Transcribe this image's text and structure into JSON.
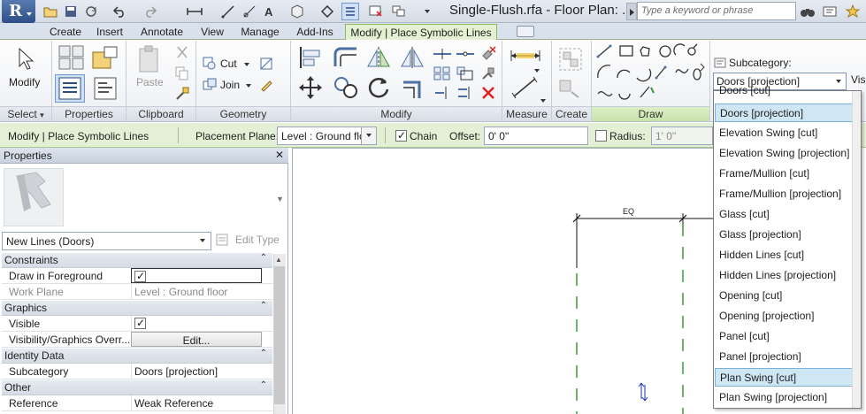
{
  "title_bar": {
    "app_logo": "R",
    "document_title": "Single-Flush.rfa - Floor Plan: ...",
    "search_placeholder": "Type a keyword or phrase"
  },
  "tabs": [
    {
      "label": "Create"
    },
    {
      "label": "Insert"
    },
    {
      "label": "Annotate"
    },
    {
      "label": "View"
    },
    {
      "label": "Manage"
    },
    {
      "label": "Add-Ins"
    },
    {
      "label": "Modify | Place Symbolic Lines",
      "active": true
    }
  ],
  "ribbon": {
    "select": {
      "button_label": "Modify",
      "panel_label": "Select"
    },
    "properties": {
      "panel_label": "Properties"
    },
    "clipboard": {
      "paste_label": "Paste",
      "panel_label": "Clipboard"
    },
    "geometry": {
      "cut_label": "Cut",
      "join_label": "Join",
      "panel_label": "Geometry"
    },
    "modify": {
      "panel_label": "Modify"
    },
    "measure": {
      "panel_label": "Measure"
    },
    "create": {
      "panel_label": "Create"
    },
    "draw": {
      "panel_label": "Draw"
    },
    "subcategory": {
      "label": "Subcategory:",
      "selected": "Doors [projection]",
      "vis_label": "Vis"
    }
  },
  "options_bar": {
    "context_label": "Modify | Place Symbolic Lines",
    "placement_plane_label": "Placement Plane:",
    "placement_plane_value": "Level : Ground flo",
    "chain_label": "Chain",
    "chain_checked": true,
    "offset_label": "Offset:",
    "offset_value": "0'  0\"",
    "radius_label": "Radius:",
    "radius_checked": false,
    "radius_value": "1'  0\""
  },
  "properties": {
    "title": "Properties",
    "type_selector": "New Lines (Doors)",
    "edit_type_label": "Edit Type",
    "categories": [
      {
        "name": "Constraints",
        "rows": [
          {
            "name": "Draw in Foreground",
            "value": "",
            "checkbox": true
          },
          {
            "name": "Work Plane",
            "value": "Level : Ground floor",
            "dim": true
          }
        ]
      },
      {
        "name": "Graphics",
        "rows": [
          {
            "name": "Visible",
            "value": "",
            "checkbox": true
          },
          {
            "name": "Visibility/Graphics Overr...",
            "value": "Edit...",
            "button": true
          }
        ]
      },
      {
        "name": "Identity Data",
        "rows": [
          {
            "name": "Subcategory",
            "value": "Doors [projection]"
          }
        ]
      },
      {
        "name": "Other",
        "rows": [
          {
            "name": "Reference",
            "value": "Weak Reference"
          }
        ]
      }
    ]
  },
  "canvas": {
    "dimension_label": "EQ"
  },
  "subcategory_list": {
    "options": [
      {
        "label": "Doors [cut]"
      },
      {
        "label": "Doors [projection]",
        "selected": true
      },
      {
        "label": "Elevation Swing [cut]"
      },
      {
        "label": "Elevation Swing [projection]"
      },
      {
        "label": "Frame/Mullion [cut]"
      },
      {
        "label": "Frame/Mullion [projection]"
      },
      {
        "label": "Glass [cut]"
      },
      {
        "label": "Glass [projection]"
      },
      {
        "label": "Hidden Lines [cut]"
      },
      {
        "label": "Hidden Lines [projection]"
      },
      {
        "label": "Opening [cut]"
      },
      {
        "label": "Opening [projection]"
      },
      {
        "label": "Panel [cut]"
      },
      {
        "label": "Panel [projection]"
      },
      {
        "label": "Plan Swing [cut]",
        "hover": true
      },
      {
        "label": "Plan Swing [projection]"
      }
    ]
  },
  "colors": {
    "accent_green": "#e4f0d6",
    "selection_blue": "#cfe6f5",
    "dashed_line": "#3a9a3a"
  }
}
